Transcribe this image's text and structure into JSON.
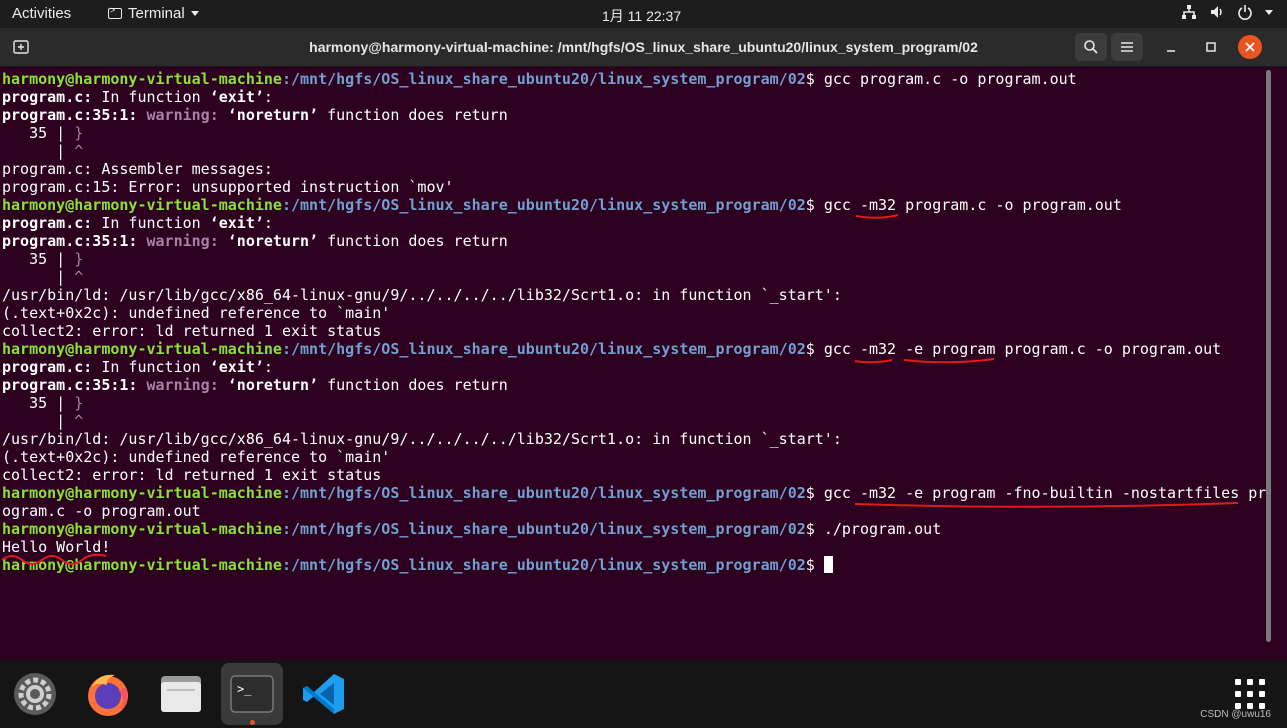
{
  "topbar": {
    "activities": "Activities",
    "app_name": "Terminal",
    "clock": "1月 11  22:37"
  },
  "window": {
    "title": "harmony@harmony-virtual-machine: /mnt/hgfs/OS_linux_share_ubuntu20/linux_system_program/02"
  },
  "terminal": {
    "user_host": "harmony@harmony-virtual-machine",
    "path": ":/mnt/hgfs/OS_linux_share_ubuntu20/linux_system_program/02",
    "prompt_sign": "$ ",
    "cmd1": "gcc program.c -o program.out",
    "cmd2": "gcc -m32 program.c -o program.out",
    "cmd3": "gcc -m32 -e program program.c -o program.out",
    "cmd4_line1": "gcc -m32 -e program -fno-builtin -nostartfiles pr",
    "cmd4_line2": "ogram.c -o program.out",
    "cmd5": "./program.out",
    "in_function_prefix": "program.c:",
    "in_function_mid": " In function ",
    "in_function_name": "‘exit’",
    "in_function_suffix": ":",
    "warn_loc": "program.c:35:1:",
    "warn_label": " warning:",
    "warn_noreturn": " ‘noreturn’",
    "warn_rest": " function does return",
    "src_line": "   35 | ",
    "src_brace": "}",
    "caret_line": "      | ",
    "caret": "^",
    "asm_msg": "program.c: Assembler messages:",
    "asm_err": "program.c:15: Error: unsupported instruction `mov'",
    "ld_err": "/usr/bin/ld: /usr/lib/gcc/x86_64-linux-gnu/9/../../../../lib32/Scrt1.o: in function `_start':",
    "undef_ref": "(.text+0x2c): undefined reference to `main'",
    "collect2": "collect2: error: ld returned 1 exit status",
    "hello": "Hello World!"
  },
  "dock": {
    "items": [
      "settings-icon",
      "firefox-icon",
      "files-icon",
      "terminal-icon",
      "vscode-icon"
    ],
    "show_apps": "apps-grid-icon"
  },
  "watermark": "CSDN @uwu16",
  "colors": {
    "terminal_bg": "#2c001e",
    "user_green": "#8ae234",
    "path_blue": "#729fcf",
    "warning_magenta": "#ad7fa8",
    "underline_red": "#e01b1b",
    "ubuntu_orange": "#e95420"
  }
}
